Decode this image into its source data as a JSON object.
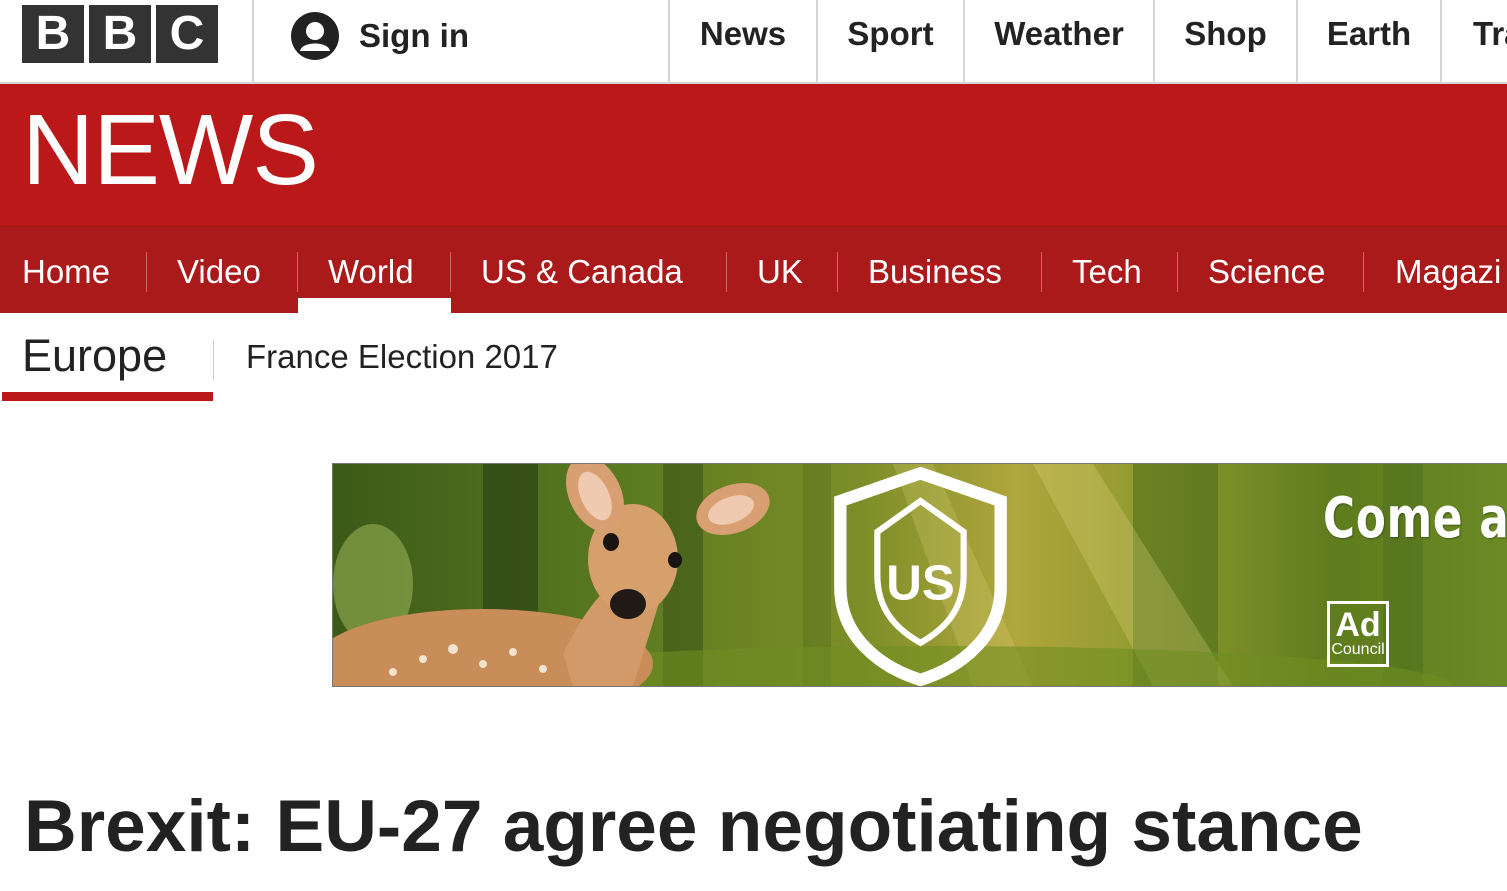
{
  "brand": {
    "logo_letters": [
      "B",
      "B",
      "C"
    ]
  },
  "account": {
    "signin_label": "Sign in",
    "icon": "user-icon"
  },
  "top_nav": {
    "items": [
      {
        "label": "News"
      },
      {
        "label": "Sport"
      },
      {
        "label": "Weather"
      },
      {
        "label": "Shop"
      },
      {
        "label": "Earth"
      },
      {
        "label": "Tra"
      }
    ]
  },
  "news_banner": {
    "wordmark": "NEWS",
    "color": "#bb1919"
  },
  "section_nav": {
    "active": "World",
    "items": [
      {
        "label": "Home"
      },
      {
        "label": "Video"
      },
      {
        "label": "World"
      },
      {
        "label": "US & Canada"
      },
      {
        "label": "UK"
      },
      {
        "label": "Business"
      },
      {
        "label": "Tech"
      },
      {
        "label": "Science"
      },
      {
        "label": "Magazi"
      }
    ]
  },
  "sub_nav": {
    "current": "Europe",
    "items": [
      {
        "label": "France Election 2017"
      }
    ]
  },
  "advert": {
    "headline": "Come a",
    "logo_ad_council": {
      "line1": "Ad",
      "line2": "Council"
    },
    "logo_forest_service": "US",
    "image": "fawn-in-forest"
  },
  "article": {
    "headline": "Brexit: EU-27 agree negotiating stance"
  },
  "colors": {
    "bbc_red": "#bb1919",
    "nav_red": "#aa1a1a",
    "logo_dark": "#333333"
  }
}
